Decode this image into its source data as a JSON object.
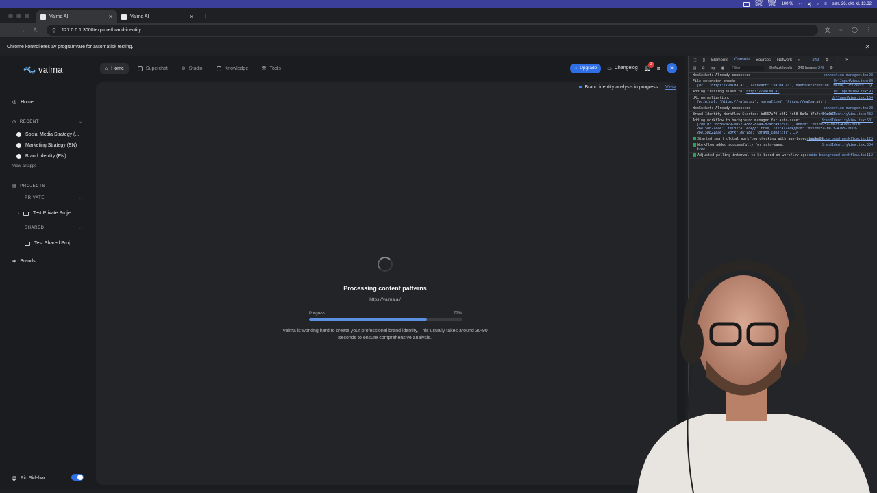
{
  "system": {
    "cpu_label": "CPU",
    "cpu_value": "50%",
    "mem_label": "MEM",
    "mem_value": "50%",
    "battery": "100 %",
    "datetime": "søn. 26. okt. kl. 13.32"
  },
  "browser": {
    "tabs": [
      {
        "title": "Valma AI"
      },
      {
        "title": "Valma AI"
      }
    ],
    "url": "127.0.0.1:3000/explore/brand-identity",
    "automation_notice": "Chrome kontrolleres av programvare for automatisk testing."
  },
  "app": {
    "brand": "valma",
    "nav": {
      "home": "Home",
      "superchat": "Superchat",
      "studio": "Studio",
      "knowledge": "Knowledge",
      "tools": "Tools"
    },
    "upgrade": "Upgrade",
    "changelog": "Changelog",
    "notifications_count": "3",
    "avatar_initial": "S",
    "accent": "#2f6fe6"
  },
  "sidebar": {
    "home": "Home",
    "recent_label": "RECENT",
    "recent": [
      "Social Media Strategy (...",
      "Marketing Strategy (EN)",
      "Brand Identity (EN)"
    ],
    "view_all": "View all apps",
    "projects_label": "PROJECTS",
    "private_label": "PRIVATE",
    "private_project": "Test Private Proje...",
    "shared_label": "SHARED",
    "shared_project": "Test Shared Proj...",
    "brands": "Brands",
    "pin_sidebar": "Pin Sidebar"
  },
  "main": {
    "notice": "Brand identity analysis in progress...",
    "notice_link": "View",
    "title": "Processing content patterns",
    "url": "https://valma.ai/",
    "progress_label": "Progress",
    "progress_text": "77%",
    "progress_value": 77,
    "description": "Valma is working hard to create your professional brand identity. This usually takes around 30-90 seconds to ensure comprehensive analysis."
  },
  "devtools": {
    "tabs": [
      "Elements",
      "Console",
      "Sources",
      "Network"
    ],
    "active_tab": "Console",
    "issues_count": "249",
    "context": "top",
    "filter_placeholder": "Filter",
    "levels": "Default levels",
    "issues_label": "249 Issues:",
    "issues_badge": "248",
    "logs": [
      {
        "text": "WebSocket: Already connected",
        "src": "connection-manager.ts:98"
      },
      {
        "text": "File extension check:",
        "src": "UrlInputView.tsx:89",
        "sub": "{url: 'https://valma.ai', lastPart: 'valma.ai', hasFileExtension: false, urlParts: 3}"
      },
      {
        "text": "Adding trailing slash to:",
        "link": "https://valma.ai",
        "src": "UrlInputView.tsx:93"
      },
      {
        "text": "URL normalization:",
        "src": "UrlInputView.tsx:104",
        "sub": "{original: 'https://valma.ai', normalized: 'https://valma.ai/'}"
      },
      {
        "text": "WebSocket: Already connected",
        "src": "connection-manager.ts:98"
      },
      {
        "text": "Brand Identity Workflow Started: bd567a79-e052-4d68-8a4a-d7afc491c9c7",
        "src": "BrandIdentityView.tsx:482"
      },
      {
        "text": "Adding workflow to background manager for auto-save:",
        "src": "BrandIdentityView.tsx:501",
        "sub": "{runId: 'bd567a79-e052-4d68-8a4a-d7afc491c9c7', appId: 'd21dd25a-0e73-4795-0870-26e15bb21aae', isInstalledApp: true, installedAppId: 'd21dd25a-0e73-4795-0870-26e15bb21aae', workflowType: 'brand_identity', …}"
      },
      {
        "text": "Started smart global workflow checking with age-based backoff",
        "src": "redis-background-workflow.ts:123",
        "ok": true
      },
      {
        "text": "Workflow added successfully for auto-save:",
        "src": "BrandIdentityView.tsx:504",
        "sub": "true",
        "ok": true
      },
      {
        "text": "Adjusted polling interval to 5s based on workflow age",
        "src": "redis-background-workflow.ts:112",
        "ok": true
      }
    ]
  }
}
